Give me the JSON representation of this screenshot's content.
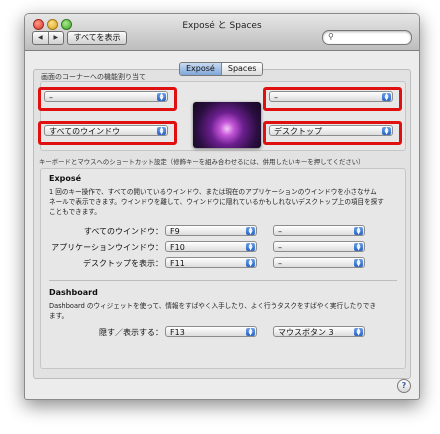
{
  "window": {
    "title": "Exposé と Spaces"
  },
  "toolbar": {
    "back": "◀",
    "forward": "▶",
    "show_all": "すべてを表示",
    "search_icon": "magnifier-icon",
    "search_value": ""
  },
  "tabs": [
    {
      "label": "Exposé",
      "active": true
    },
    {
      "label": "Spaces",
      "active": false
    }
  ],
  "corners": {
    "label": "画面のコーナーへの機能割り当て",
    "top_left": "–",
    "top_right": "–",
    "bottom_left": "すべてのウインドウ",
    "bottom_right": "デスクトップ",
    "highlight_color": "#e01010"
  },
  "keyboard": {
    "label": "キーボードとマウスへのショートカット設定（修飾キーを組み合わせるには、併用したいキーを押してください）",
    "expose": {
      "heading": "Exposé",
      "description_line1": "1 回のキー操作で、すべての開いているウインドウ、または現在のアプリケーションのウインドウを小さなサム",
      "description_line2": "ネールで表示できます。ウインドウを離して、ウインドウに隠れているかもしれないデスクトップ上の項目を探す",
      "description_line3": "こともできます。",
      "rows": [
        {
          "label": "すべてのウインドウ：",
          "key": "F9",
          "mouse": "–"
        },
        {
          "label": "アプリケーションウインドウ：",
          "key": "F10",
          "mouse": "–"
        },
        {
          "label": "デスクトップを表示：",
          "key": "F11",
          "mouse": "–"
        }
      ]
    },
    "dashboard": {
      "heading": "Dashboard",
      "description_line1": "Dashboard のウィジェットを使って、情報をすばやく入手したり、よく行うタスクをすばやく実行したりでき",
      "description_line2": "ます。",
      "row": {
        "label": "隠す／表示する：",
        "key": "F13",
        "mouse": "マウスボタン 3"
      }
    }
  },
  "help": "?"
}
